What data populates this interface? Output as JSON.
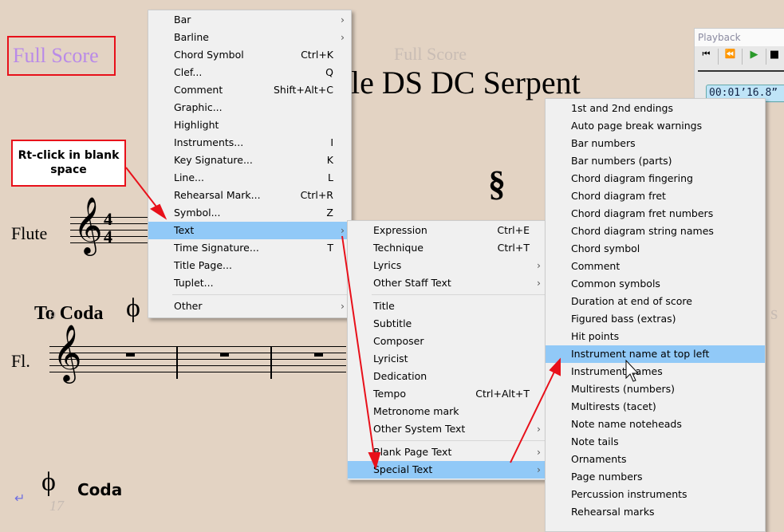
{
  "score": {
    "part_name": "Full Score",
    "part_name_ghost": "Full Score",
    "title": "ple DS DC Serpent",
    "instrument": "Flute",
    "instrument_short": "Fl.",
    "to_coda": "To Coda",
    "coda": "Coda",
    "bar_9": "9",
    "bar_17": "17",
    "segno": "§",
    "time_sig_top": "4",
    "time_sig_bottom": "4",
    "right_edge_text": "s"
  },
  "callout": {
    "text": "Rt-click in blank space"
  },
  "playback": {
    "title": "Playback",
    "time": "00:01’16.8”"
  },
  "menu1": [
    {
      "label": "Bar",
      "sub": true
    },
    {
      "label": "Barline",
      "sub": true
    },
    {
      "label": "Chord Symbol",
      "shortcut": "Ctrl+K"
    },
    {
      "label": "Clef...",
      "shortcut": "Q"
    },
    {
      "label": "Comment",
      "shortcut": "Shift+Alt+C"
    },
    {
      "label": "Graphic..."
    },
    {
      "label": "Highlight"
    },
    {
      "label": "Instruments...",
      "shortcut": "I"
    },
    {
      "label": "Key Signature...",
      "shortcut": "K"
    },
    {
      "label": "Line...",
      "shortcut": "L"
    },
    {
      "label": "Rehearsal Mark...",
      "shortcut": "Ctrl+R"
    },
    {
      "label": "Symbol...",
      "shortcut": "Z"
    },
    {
      "label": "Text",
      "sub": true,
      "highlighted": true
    },
    {
      "label": "Time Signature...",
      "shortcut": "T"
    },
    {
      "label": "Title Page..."
    },
    {
      "label": "Tuplet..."
    },
    {
      "separator": true
    },
    {
      "label": "Other",
      "sub": true
    }
  ],
  "menu2": [
    {
      "label": "Expression",
      "shortcut": "Ctrl+E"
    },
    {
      "label": "Technique",
      "shortcut": "Ctrl+T"
    },
    {
      "label": "Lyrics",
      "sub": true
    },
    {
      "label": "Other Staff Text",
      "sub": true
    },
    {
      "separator": true
    },
    {
      "label": "Title"
    },
    {
      "label": "Subtitle"
    },
    {
      "label": "Composer"
    },
    {
      "label": "Lyricist"
    },
    {
      "label": "Dedication"
    },
    {
      "label": "Tempo",
      "shortcut": "Ctrl+Alt+T"
    },
    {
      "label": "Metronome mark"
    },
    {
      "label": "Other System Text",
      "sub": true
    },
    {
      "separator": true
    },
    {
      "label": "Blank Page Text",
      "sub": true
    },
    {
      "label": "Special Text",
      "sub": true,
      "highlighted": true
    }
  ],
  "menu3": [
    {
      "label": "1st and 2nd endings"
    },
    {
      "label": "Auto page break warnings"
    },
    {
      "label": "Bar numbers"
    },
    {
      "label": "Bar numbers (parts)"
    },
    {
      "label": "Chord diagram fingering"
    },
    {
      "label": "Chord diagram fret"
    },
    {
      "label": "Chord diagram fret numbers"
    },
    {
      "label": "Chord diagram string names"
    },
    {
      "label": "Chord symbol"
    },
    {
      "label": "Comment"
    },
    {
      "label": "Common symbols"
    },
    {
      "label": "Duration at end of score"
    },
    {
      "label": "Figured bass (extras)"
    },
    {
      "label": "Hit points"
    },
    {
      "label": "Instrument name at top left",
      "highlighted": true
    },
    {
      "label": "Instrument names"
    },
    {
      "label": "Multirests (numbers)"
    },
    {
      "label": "Multirests (tacet)"
    },
    {
      "label": "Note name noteheads"
    },
    {
      "label": "Note tails"
    },
    {
      "label": "Ornaments"
    },
    {
      "label": "Page numbers"
    },
    {
      "label": "Percussion instruments"
    },
    {
      "label": "Rehearsal marks"
    }
  ],
  "colors": {
    "highlight": "#91c9f7",
    "annotation": "#ff0000",
    "part_name": "#b98ae8",
    "paper": "#e3d3c3"
  }
}
